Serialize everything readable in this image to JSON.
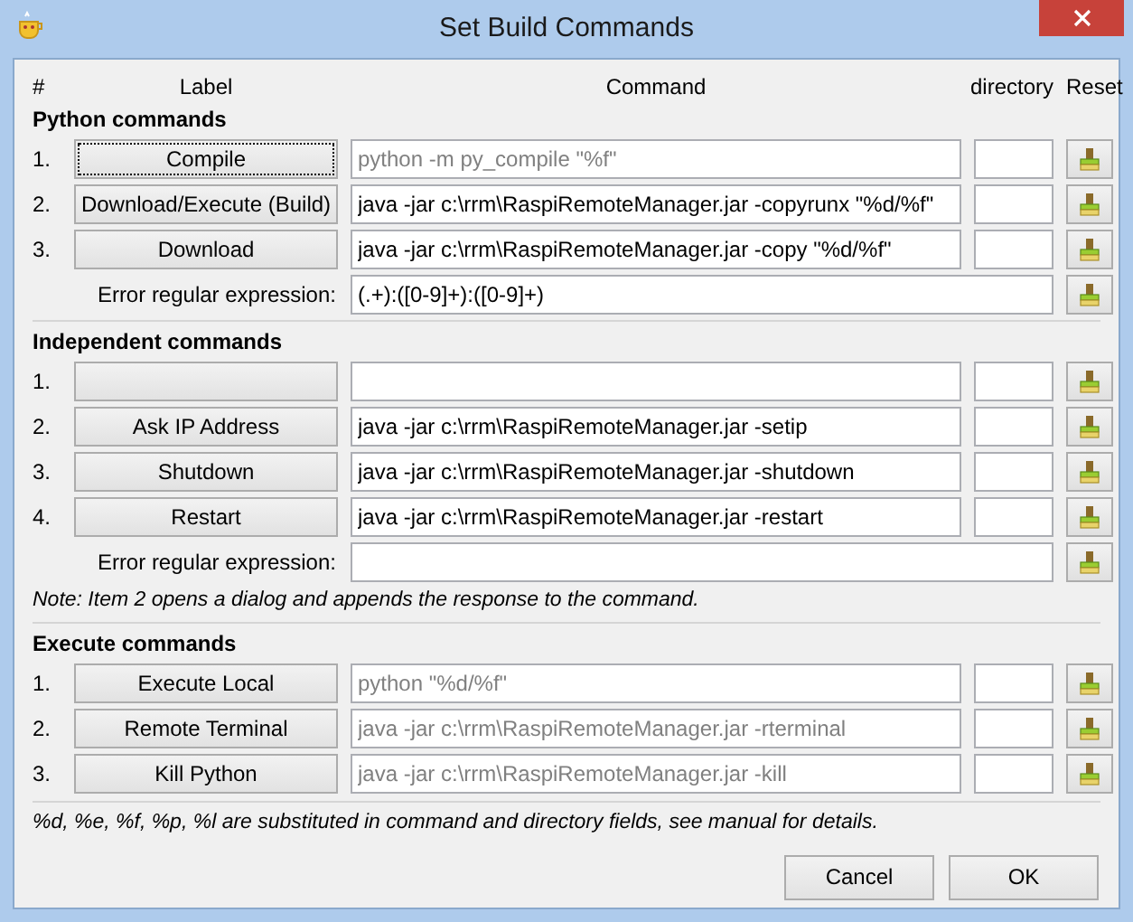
{
  "window": {
    "title": "Set Build Commands"
  },
  "columns": [
    "#",
    "Label",
    "Command",
    "directory",
    "Reset"
  ],
  "sections": [
    {
      "title": "Python commands",
      "rows": [
        {
          "kind": "command",
          "number": "1.",
          "label": "Compile",
          "focused": true,
          "placeholder": "python -m py_compile \"%f\""
        },
        {
          "kind": "command",
          "number": "2.",
          "label": "Download/Execute (Build)",
          "focused": false,
          "value": "java -jar c:\\rrm\\RaspiRemoteManager.jar -copyrunx \"%d/%f\""
        },
        {
          "kind": "command",
          "number": "3.",
          "label": "Download",
          "focused": false,
          "value": "java -jar c:\\rrm\\RaspiRemoteManager.jar -copy \"%d/%f\""
        },
        {
          "kind": "error_regex",
          "label": "Error regular expression:",
          "value": "(.+):([0-9]+):([0-9]+)"
        }
      ]
    },
    {
      "title": "Independent commands",
      "rows": [
        {
          "kind": "command",
          "number": "1.",
          "focused": false
        },
        {
          "kind": "command",
          "number": "2.",
          "label": "Ask IP Address",
          "focused": false,
          "value": "java -jar c:\\rrm\\RaspiRemoteManager.jar -setip"
        },
        {
          "kind": "command",
          "number": "3.",
          "label": "Shutdown",
          "focused": false,
          "value": "java -jar c:\\rrm\\RaspiRemoteManager.jar -shutdown"
        },
        {
          "kind": "command",
          "number": "4.",
          "label": "Restart",
          "focused": false,
          "value": "java -jar c:\\rrm\\RaspiRemoteManager.jar -restart"
        },
        {
          "kind": "error_regex",
          "label": "Error regular expression:"
        }
      ],
      "note": "Note: Item 2 opens a dialog and appends the response to the command."
    },
    {
      "title": "Execute commands",
      "rows": [
        {
          "kind": "command",
          "number": "1.",
          "label": "Execute Local",
          "focused": false,
          "placeholder": "python \"%d/%f\""
        },
        {
          "kind": "command",
          "number": "2.",
          "label": "Remote Terminal",
          "focused": false,
          "placeholder": "java -jar c:\\rrm\\RaspiRemoteManager.jar -rterminal"
        },
        {
          "kind": "command",
          "number": "3.",
          "label": "Kill Python",
          "focused": false,
          "placeholder": "java -jar c:\\rrm\\RaspiRemoteManager.jar -kill"
        }
      ]
    }
  ],
  "footer_note": "%d, %e, %f, %p, %l are substituted in command and directory fields, see manual for details.",
  "buttons": [
    "Cancel",
    "OK"
  ]
}
